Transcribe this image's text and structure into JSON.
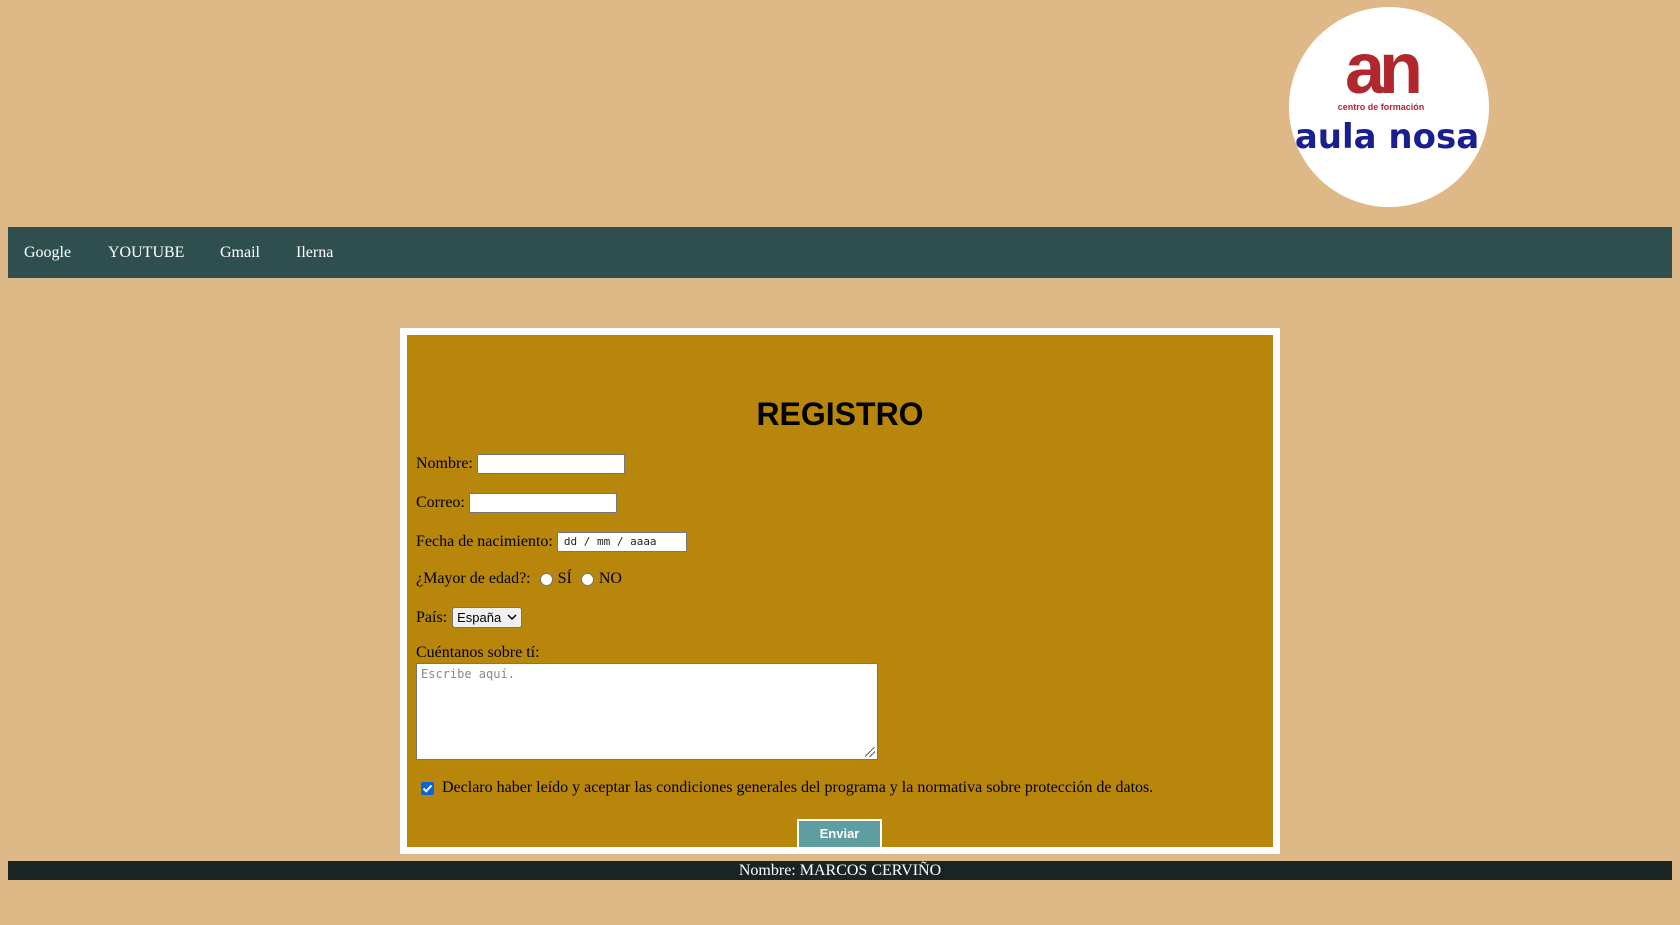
{
  "header": {
    "logo": {
      "monogram": "an",
      "tagline": "centro de formación",
      "name": "aula nosa",
      "colors": {
        "monogram": "#b0282e",
        "name": "#1a1f8f",
        "tagline": "#b0282e"
      }
    }
  },
  "nav": {
    "links": [
      {
        "label": "Google"
      },
      {
        "label": "YOUTUBE"
      },
      {
        "label": "Gmail"
      },
      {
        "label": "Ilerna"
      }
    ]
  },
  "form": {
    "title": "REGISTRO",
    "name_label": "Nombre:",
    "name_value": "",
    "email_label": "Correo:",
    "email_value": "",
    "birth_label": "Fecha de nacimiento:",
    "birth_placeholder": "dd / mm / aaaa",
    "adult_label": "¿Mayor de edad?:",
    "adult_yes": "SÍ",
    "adult_no": "NO",
    "country_label": "País:",
    "country_selected": "España",
    "about_label": "Cuéntanos sobre tí:",
    "about_placeholder": "Escribe aquí.",
    "consent_checked": true,
    "consent_text": "Declaro haber leído y aceptar las condiciones generales del programa y la normativa sobre protección de datos.",
    "submit_label": "Enviar"
  },
  "footer": {
    "text": "Nombre: MARCOS CERVIÑO"
  },
  "colors": {
    "page_bg": "#deb887",
    "nav_bg": "#2f4f4f",
    "form_bg": "#b8860b",
    "button_bg": "#5f9ea0",
    "footer_bg": "#1b2424",
    "checkbox": "#0a64d8"
  }
}
